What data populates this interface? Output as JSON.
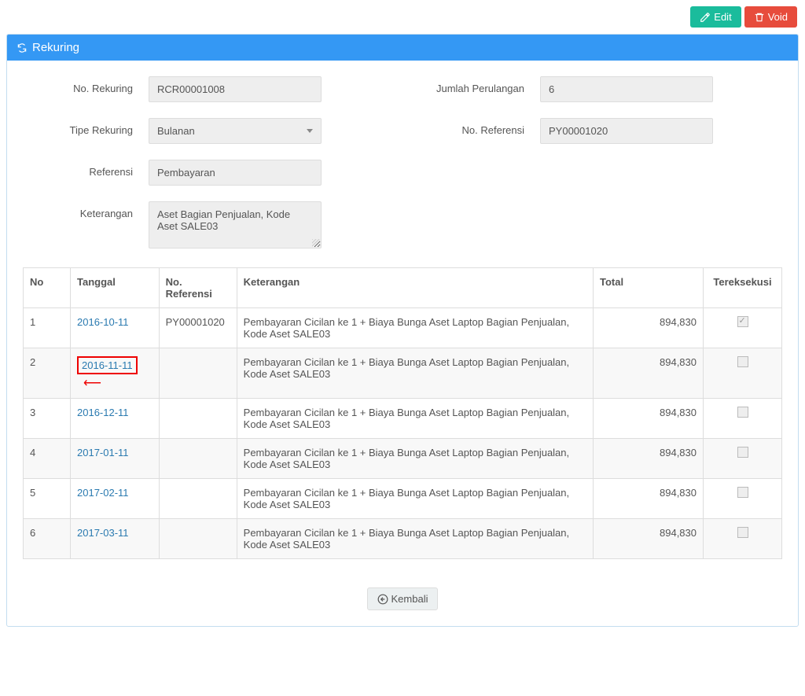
{
  "actions": {
    "edit_label": "Edit",
    "void_label": "Void",
    "back_label": "Kembali"
  },
  "panel": {
    "title": "Rekuring"
  },
  "form": {
    "no_rekuring_label": "No. Rekuring",
    "no_rekuring_value": "RCR00001008",
    "tipe_rekuring_label": "Tipe Rekuring",
    "tipe_rekuring_value": "Bulanan",
    "referensi_label": "Referensi",
    "referensi_value": "Pembayaran",
    "keterangan_label": "Keterangan",
    "keterangan_value": "Aset Bagian Penjualan, Kode Aset SALE03",
    "jumlah_perulangan_label": "Jumlah Perulangan",
    "jumlah_perulangan_value": "6",
    "no_referensi_label": "No. Referensi",
    "no_referensi_value": "PY00001020"
  },
  "table": {
    "headers": {
      "no": "No",
      "tanggal": "Tanggal",
      "no_referensi": "No. Referensi",
      "keterangan": "Keterangan",
      "total": "Total",
      "tereksekusi": "Tereksekusi"
    },
    "rows": [
      {
        "no": "1",
        "tanggal": "2016-10-11",
        "no_referensi": "PY00001020",
        "keterangan": "Pembayaran Cicilan ke 1 + Biaya Bunga Aset Laptop Bagian Penjualan, Kode Aset SALE03",
        "total": "894,830",
        "executed": true,
        "highlighted": false
      },
      {
        "no": "2",
        "tanggal": "2016-11-11",
        "no_referensi": "",
        "keterangan": "Pembayaran Cicilan ke 1 + Biaya Bunga Aset Laptop Bagian Penjualan, Kode Aset SALE03",
        "total": "894,830",
        "executed": false,
        "highlighted": true
      },
      {
        "no": "3",
        "tanggal": "2016-12-11",
        "no_referensi": "",
        "keterangan": "Pembayaran Cicilan ke 1 + Biaya Bunga Aset Laptop Bagian Penjualan, Kode Aset SALE03",
        "total": "894,830",
        "executed": false,
        "highlighted": false
      },
      {
        "no": "4",
        "tanggal": "2017-01-11",
        "no_referensi": "",
        "keterangan": "Pembayaran Cicilan ke 1 + Biaya Bunga Aset Laptop Bagian Penjualan, Kode Aset SALE03",
        "total": "894,830",
        "executed": false,
        "highlighted": false
      },
      {
        "no": "5",
        "tanggal": "2017-02-11",
        "no_referensi": "",
        "keterangan": "Pembayaran Cicilan ke 1 + Biaya Bunga Aset Laptop Bagian Penjualan, Kode Aset SALE03",
        "total": "894,830",
        "executed": false,
        "highlighted": false
      },
      {
        "no": "6",
        "tanggal": "2017-03-11",
        "no_referensi": "",
        "keterangan": "Pembayaran Cicilan ke 1 + Biaya Bunga Aset Laptop Bagian Penjualan, Kode Aset SALE03",
        "total": "894,830",
        "executed": false,
        "highlighted": false
      }
    ]
  }
}
